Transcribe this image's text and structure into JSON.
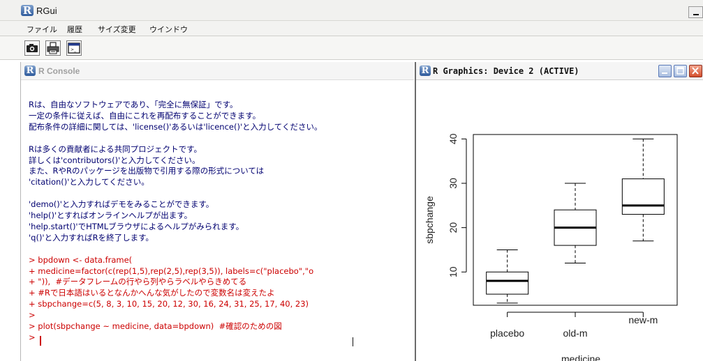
{
  "app": {
    "title": "RGui",
    "logo_letter": "R"
  },
  "menubar": {
    "items": [
      "ファイル",
      "履歴",
      "サイズ変更",
      "ウインドウ"
    ]
  },
  "toolbar": {
    "buttons": [
      {
        "name": "camera-icon"
      },
      {
        "name": "printer-icon"
      },
      {
        "name": "window-icon"
      }
    ]
  },
  "console": {
    "title": "R Console",
    "lines": [
      {
        "text": "Rは、自由なソフトウェアであり、「完全に無保証」です。",
        "kind": "out"
      },
      {
        "text": "一定の条件に従えば、自由にこれを再配布することができます。",
        "kind": "out"
      },
      {
        "text": "配布条件の詳細に関しては、'license()'あるいは'licence()'と入力してください。",
        "kind": "out"
      },
      {
        "text": "",
        "kind": "out"
      },
      {
        "text": "Rは多くの貢献者による共同プロジェクトです。",
        "kind": "out"
      },
      {
        "text": "詳しくは'contributors()'と入力してください。",
        "kind": "out"
      },
      {
        "text": "また、RやRのパッケージを出版物で引用する際の形式については",
        "kind": "out"
      },
      {
        "text": "'citation()'と入力してください。",
        "kind": "out"
      },
      {
        "text": "",
        "kind": "out"
      },
      {
        "text": "'demo()'と入力すればデモをみることができます。",
        "kind": "out"
      },
      {
        "text": "'help()'とすればオンラインヘルプが出ます。",
        "kind": "out"
      },
      {
        "text": "'help.start()'でHTMLブラウザによるヘルプがみられます。",
        "kind": "out"
      },
      {
        "text": "'q()'と入力すればRを終了します。",
        "kind": "out"
      },
      {
        "text": "",
        "kind": "out"
      },
      {
        "text": "> bpdown <- data.frame(",
        "kind": "in"
      },
      {
        "text": "+ medicine=factor(c(rep(1,5),rep(2,5),rep(3,5)), labels=c(\"placebo\",\"o",
        "kind": "in"
      },
      {
        "text": "+ \")),  #データフレームの行やら列やらラベルやらきめてる",
        "kind": "in"
      },
      {
        "text": "+ #Rで日本語はいるとなんかへんな気がしたので変数名は変えたよ",
        "kind": "in"
      },
      {
        "text": "+ sbpchange=c(5, 8, 3, 10, 15, 20, 12, 30, 16, 24, 31, 25, 17, 40, 23)",
        "kind": "in"
      },
      {
        "text": ">",
        "kind": "in"
      },
      {
        "text": "> plot(sbpchange ~ medicine, data=bpdown)  #確認のための図",
        "kind": "in"
      },
      {
        "text": ">",
        "kind": "in"
      }
    ]
  },
  "graphics": {
    "title": "R Graphics: Device 2 (ACTIVE)",
    "buttons": [
      "minimize",
      "maximize",
      "close"
    ]
  },
  "colors": {
    "output_text": "#000070",
    "input_text": "#cc0000",
    "title_r_blue": "#2f5b9c"
  },
  "chart_data": {
    "type": "boxplot",
    "xlabel": "medicine",
    "ylabel": "sbpchange",
    "categories": [
      "placebo",
      "old-m",
      "new-m"
    ],
    "yticks": [
      10,
      20,
      30,
      40
    ],
    "ylim": [
      2.5,
      41
    ],
    "boxes": [
      {
        "name": "placebo",
        "min": 3,
        "q1": 5,
        "median": 8,
        "q3": 10,
        "max": 15
      },
      {
        "name": "old-m",
        "min": 12,
        "q1": 16,
        "median": 20,
        "q3": 24,
        "max": 30
      },
      {
        "name": "new-m",
        "min": 17,
        "q1": 23,
        "median": 25,
        "q3": 31,
        "max": 40
      }
    ]
  }
}
